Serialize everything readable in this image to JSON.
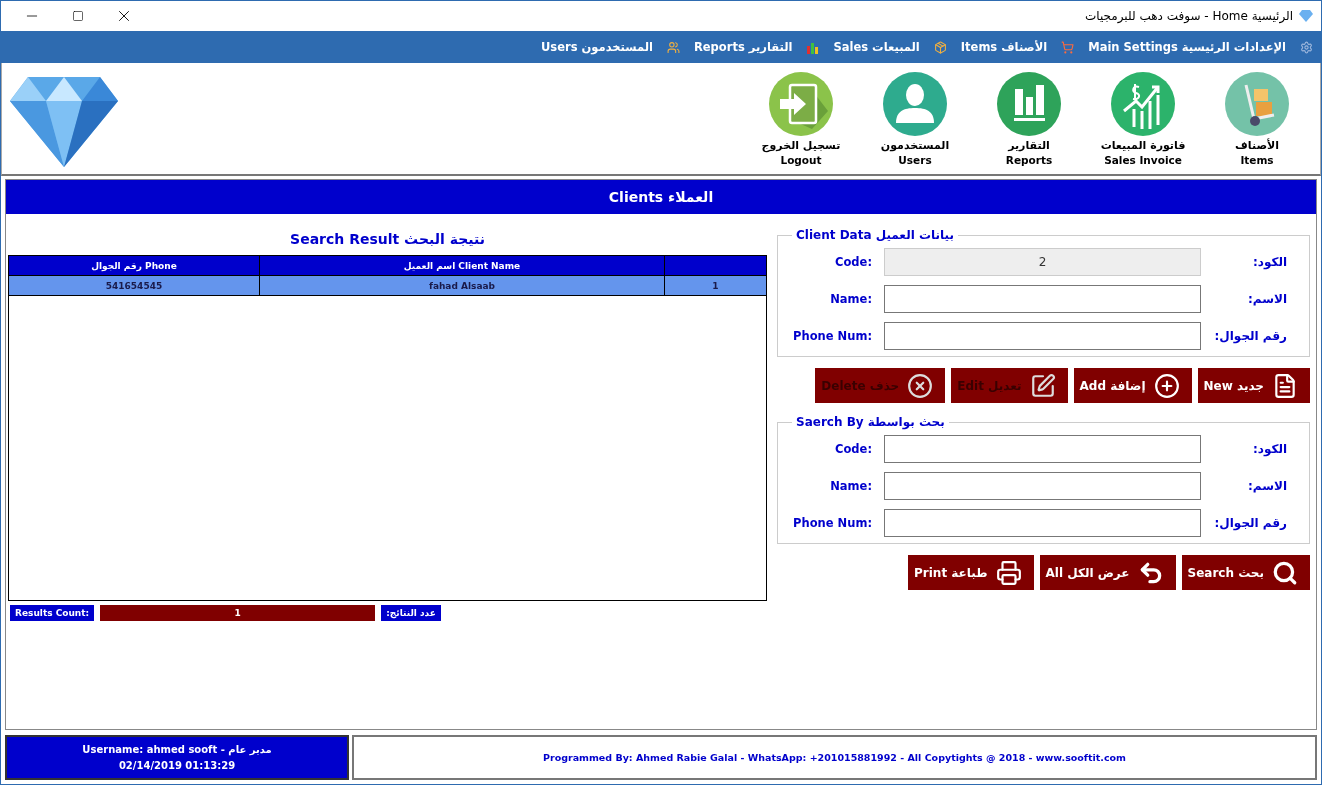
{
  "window": {
    "title": "الرئيسية Home - سوفت دهب للبرمجيات"
  },
  "menu": [
    {
      "label": "الإعدادات الرئيسية Main Settings"
    },
    {
      "label": "الأصناف Items"
    },
    {
      "label": "المبيعات Sales"
    },
    {
      "label": "التقارير Reports"
    },
    {
      "label": "المستخدمون Users"
    }
  ],
  "toolbar": [
    {
      "arabic": "الأصناف",
      "english": "Items"
    },
    {
      "arabic": "فاتورة المبيعات",
      "english": "Sales Invoice"
    },
    {
      "arabic": "التقارير",
      "english": "Reports"
    },
    {
      "arabic": "المستخدمون",
      "english": "Users"
    },
    {
      "arabic": "تسجيل الخروج",
      "english": "Logout"
    }
  ],
  "section_title": "العملاء Clients",
  "client_data": {
    "title": "بيانات العميل Client Data",
    "fields": [
      {
        "label_ar": "الكود:",
        "label_en": "Code:",
        "value": "2",
        "disabled": true
      },
      {
        "label_ar": "الاسم:",
        "label_en": "Name:",
        "disabled": false
      },
      {
        "label_ar": "رقم الجوال:",
        "label_en": "Phone Num:",
        "disabled": false
      }
    ],
    "buttons": [
      {
        "label": "جديد New",
        "disabled": false
      },
      {
        "label": "إضافة Add",
        "disabled": false
      },
      {
        "label": "تعديل Edit",
        "disabled": true
      },
      {
        "label": "حذف Delete",
        "disabled": true
      }
    ]
  },
  "search_by": {
    "title": "بحث بواسطة Saerch By",
    "fields": [
      {
        "label_ar": "الكود:",
        "label_en": "Code:",
        "disabled": false
      },
      {
        "label_ar": "الاسم:",
        "label_en": "Name:",
        "disabled": false
      },
      {
        "label_ar": "رقم الجوال:",
        "label_en": "Phone Num:",
        "disabled": false
      }
    ],
    "buttons": [
      {
        "label": "بحث Search",
        "disabled": false
      },
      {
        "label": "عرض الكل All",
        "disabled": false
      },
      {
        "label": "طباعة Print",
        "disabled": false
      }
    ]
  },
  "results": {
    "title": "نتيجة البحث Search Result",
    "columns": {
      "client_name": "اسم العميل Client Name",
      "phone": "رقم الجوال Phone"
    },
    "rows": [
      {
        "number": "1",
        "client_name": "fahad Alsaab",
        "phone": "541654545",
        "selected": true
      }
    ],
    "count_label_en": "Results Count:",
    "count": "1",
    "count_label_ar": "عدد النتائج:"
  },
  "footer": {
    "user": "Username: ahmed sooft - مدير عام",
    "datetime": "02/14/2019 01:13:29",
    "credits": "Programmed By: Ahmed Rabie Galal - WhatsApp: +201015881992 - All Copytights @ 2018 - www.sooftit.com"
  }
}
